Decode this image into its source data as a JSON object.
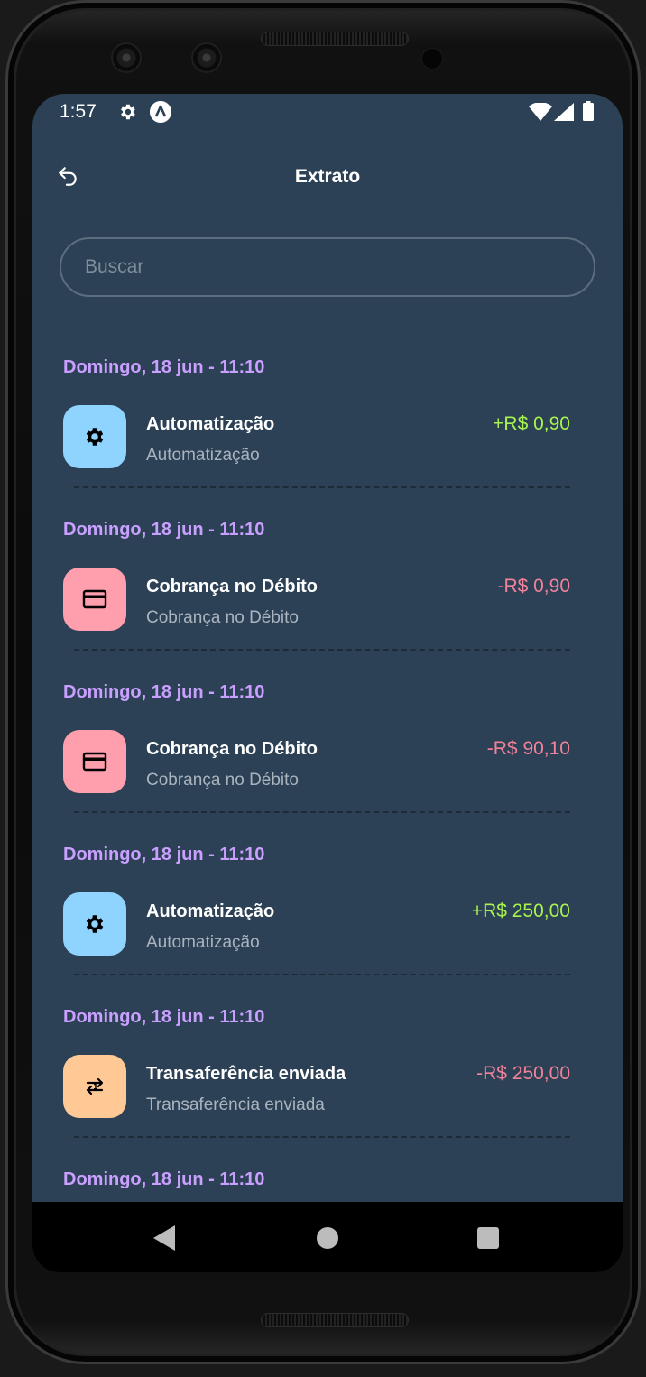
{
  "status": {
    "time": "1:57"
  },
  "header": {
    "title": "Extrato"
  },
  "search": {
    "placeholder": "Buscar",
    "value": ""
  },
  "colors": {
    "background": "#2c4155",
    "date": "#c9a0ff",
    "income": "#a7f34f",
    "expense": "#f2829a",
    "icon_settings": "#8fd3ff",
    "icon_card": "#ff9fae",
    "icon_transfer": "#ffc996"
  },
  "transactions": [
    {
      "date": "Domingo, 18 jun - 11:10",
      "title": "Automatização",
      "subtitle": "Automatização",
      "amount": "+R$ 0,90",
      "type": "income",
      "icon": "gear-icon"
    },
    {
      "date": "Domingo, 18 jun - 11:10",
      "title": "Cobrança no Débito",
      "subtitle": "Cobrança no Débito",
      "amount": "-R$ 0,90",
      "type": "expense",
      "icon": "credit-card-icon"
    },
    {
      "date": "Domingo, 18 jun - 11:10",
      "title": "Cobrança no Débito",
      "subtitle": "Cobrança no Débito",
      "amount": "-R$ 90,10",
      "type": "expense",
      "icon": "credit-card-icon"
    },
    {
      "date": "Domingo, 18 jun - 11:10",
      "title": "Automatização",
      "subtitle": "Automatização",
      "amount": "+R$ 250,00",
      "type": "income",
      "icon": "gear-icon"
    },
    {
      "date": "Domingo, 18 jun - 11:10",
      "title": "Transaferência enviada",
      "subtitle": "Transaferência enviada",
      "amount": "-R$ 250,00",
      "type": "expense",
      "icon": "transfer-icon"
    },
    {
      "date": "Domingo, 18 jun - 11:10"
    }
  ]
}
